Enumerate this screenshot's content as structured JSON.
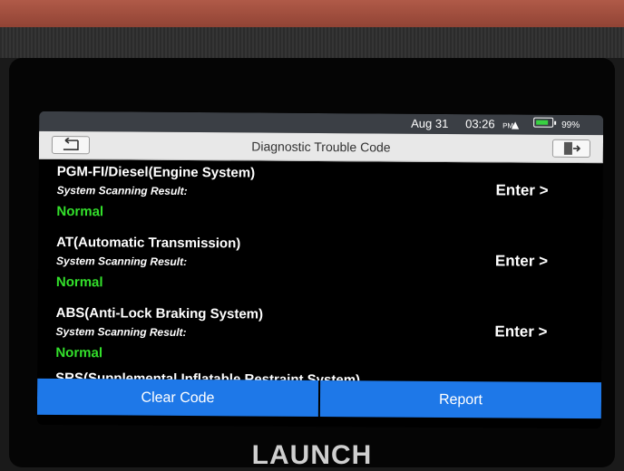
{
  "status_bar": {
    "date": "Aug 31",
    "time": "03:26",
    "ampm": "PM",
    "battery": "99%"
  },
  "header": {
    "title": "Diagnostic Trouble Code"
  },
  "systems": [
    {
      "name": "PGM-FI/Diesel(Engine System)",
      "sub_label": "System Scanning Result:",
      "result": "Normal",
      "action": "Enter >"
    },
    {
      "name": "AT(Automatic Transmission)",
      "sub_label": "System Scanning Result:",
      "result": "Normal",
      "action": "Enter >"
    },
    {
      "name": "ABS(Anti-Lock Braking System)",
      "sub_label": "System Scanning Result:",
      "result": "Normal",
      "action": "Enter >"
    }
  ],
  "partial_item": "SRS(Supplemental Inflatable Restraint System)",
  "footer": {
    "clear_code": "Clear Code",
    "report": "Report"
  },
  "device": {
    "brand": "LAUNCH"
  },
  "colors": {
    "accent": "#1e78e8",
    "result_ok": "#33e02b"
  }
}
